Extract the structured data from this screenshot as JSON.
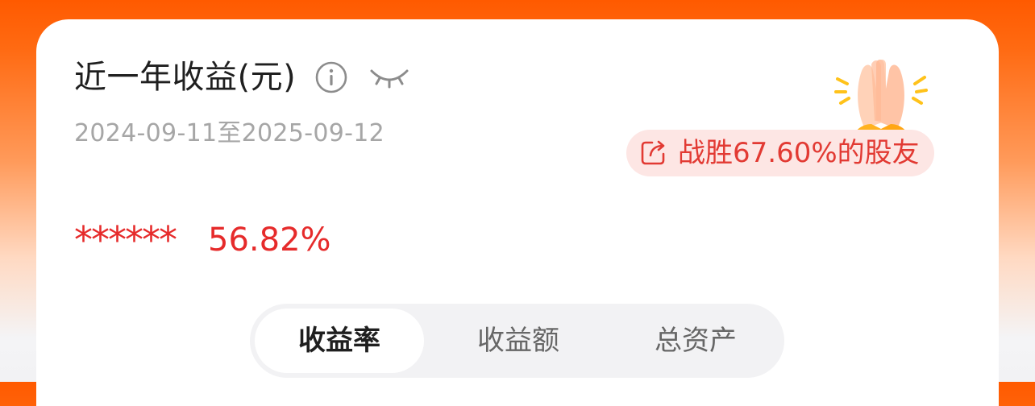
{
  "header": {
    "title": "近一年收益(元)",
    "date_range": "2024-09-11至2025-09-12"
  },
  "badge": {
    "beat_text": "战胜67.60%的股友"
  },
  "summary": {
    "masked_value": "******",
    "return_rate": "56.82%"
  },
  "tabs": [
    {
      "label": "收益率",
      "active": true
    },
    {
      "label": "收益额",
      "active": false
    },
    {
      "label": "总资产",
      "active": false
    }
  ],
  "colors": {
    "accent_orange": "#ff5a00",
    "positive_red": "#e62b2b",
    "badge_bg": "#fde6e4"
  }
}
